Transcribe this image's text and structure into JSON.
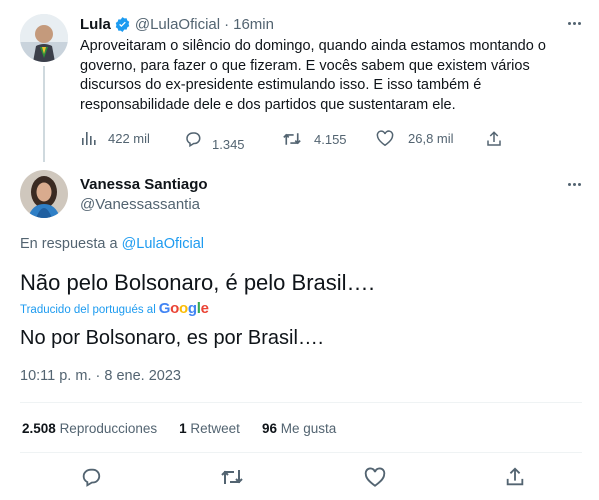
{
  "colors": {
    "accent": "#1d9bf0",
    "text": "#0f1419",
    "muted": "#536471",
    "divider": "#eff3f4"
  },
  "parent_tweet": {
    "author_name": "Lula",
    "handle": "@LulaOficial",
    "separator": "·",
    "time": "16min",
    "verified_icon": "verified-badge-icon",
    "text": "Aproveitaram o silêncio do domingo, quando ainda estamos montando o governo, para fazer o que fizeram. E vocês sabem que existem vários discursos do ex-presidente estimulando isso. E isso também é responsabilidade dele e dos partidos que sustentaram ele.",
    "views": "422 mil",
    "replies": "1.345",
    "retweets": "4.155",
    "likes": "26,8 mil"
  },
  "reply_tweet": {
    "author_name": "Vanessa Santiago",
    "handle": "@Vanessassantia",
    "reply_prefix": "En respuesta a",
    "reply_to": "@LulaOficial",
    "text": "Não pelo Bolsonaro, é pelo Brasil….",
    "translated_by": "Traducido del portugués al",
    "translator": "Google",
    "translation": "No por Bolsonaro, es por Brasil….",
    "timestamp": "10:11 p. m. · 8 ene. 2023",
    "stats": {
      "views_count": "2.508",
      "views_label": "Reproducciones",
      "retweets_count": "1",
      "retweets_label": "Retweet",
      "likes_count": "96",
      "likes_label": "Me gusta"
    }
  }
}
